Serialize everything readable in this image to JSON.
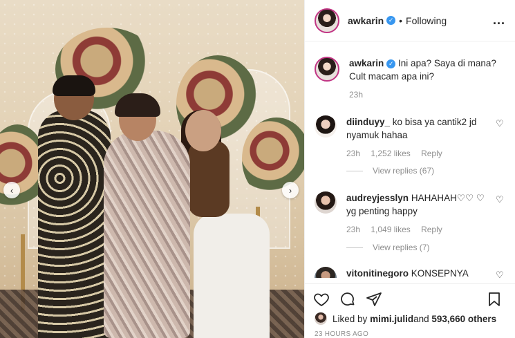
{
  "post": {
    "image_alt": "Three people posing in front of floral arrangements"
  },
  "header": {
    "username": "awkarin",
    "separator": "•",
    "follow_status": "Following",
    "more_label": "..."
  },
  "caption": {
    "username": "awkarin",
    "text": "Ini apa? Saya di mana? Cult macam apa ini?",
    "time": "23h"
  },
  "comments": [
    {
      "username": "diinduyy_",
      "text": "ko bisa ya cantik2 jd nyamuk hahaa",
      "time": "23h",
      "likes": "1,252 likes",
      "reply": "Reply",
      "view_replies": "View replies (67)"
    },
    {
      "username": "audreyjesslyn",
      "text": "HAHAHAH♡♡ ♡ yg penting happy",
      "time": "23h",
      "likes": "1,049 likes",
      "reply": "Reply",
      "view_replies": "View replies (7)"
    },
    {
      "username": "vitonitinegoro",
      "text": "KONSEPNYA"
    }
  ],
  "likes": {
    "prefix": "Liked by ",
    "user": "mimi.julid",
    "middle": " and ",
    "count": "593,660 others"
  },
  "timestamp": "23 HOURS AGO",
  "icons": {
    "prev": "‹",
    "next": "›",
    "heart": "♡"
  }
}
